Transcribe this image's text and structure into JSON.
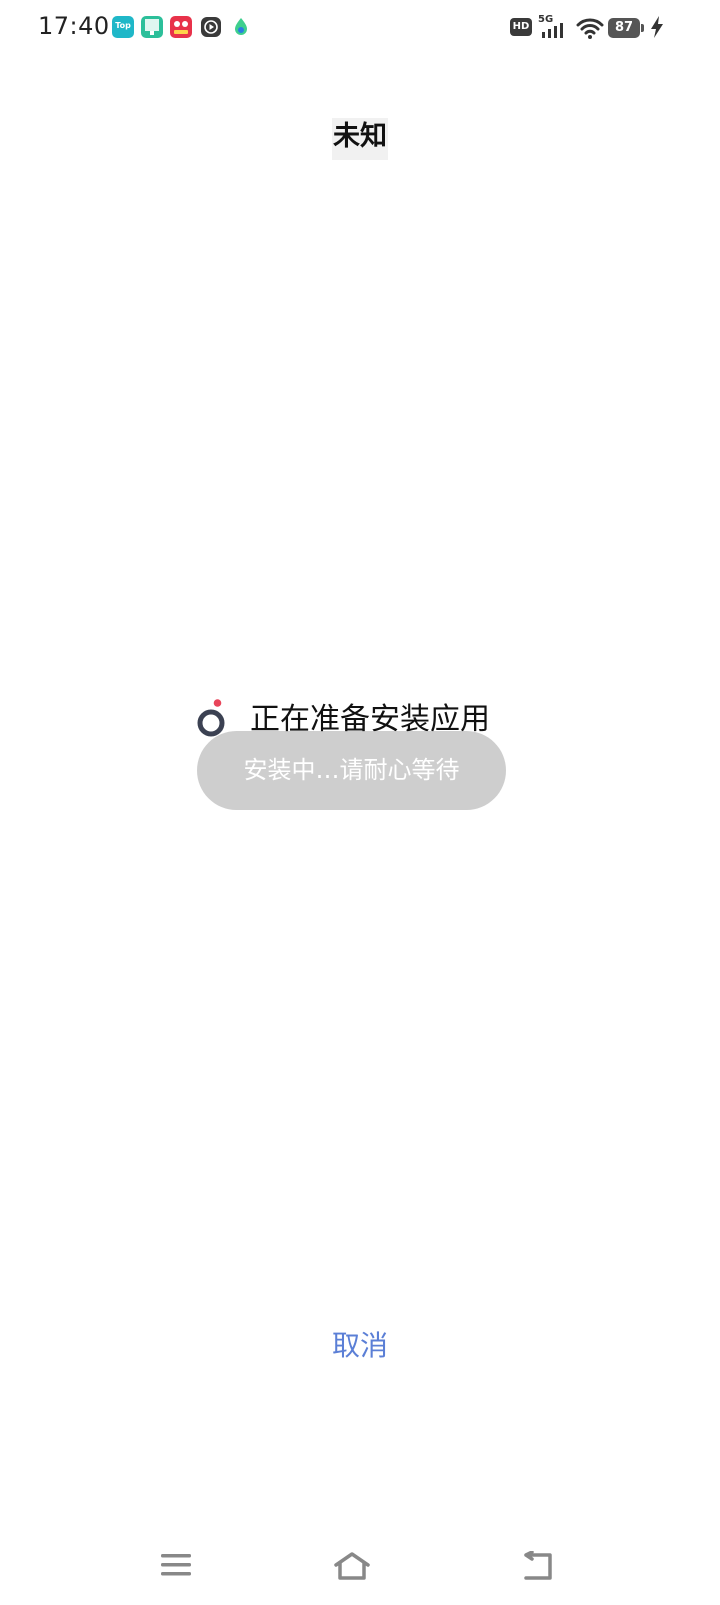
{
  "status_bar": {
    "time": "17:40",
    "notification_icons": [
      "app-top-icon",
      "app-green-icon",
      "app-red-icon",
      "media-play-icon",
      "app-green-drop-icon"
    ],
    "notification_icon_labels": {
      "app_top": "Top"
    },
    "hd_label": "HD",
    "network_label": "5G",
    "battery_level": "87"
  },
  "title": "未知",
  "progress": {
    "message": "正在准备安装应用"
  },
  "toast": {
    "message": "安装中…请耐心等待"
  },
  "actions": {
    "cancel_label": "取消"
  },
  "colors": {
    "accent": "#5b7fd6",
    "spinner_ring": "#3b4152",
    "spinner_dot": "#e8455a",
    "toast_background": "#bebebe"
  },
  "nav_bar": {
    "icons": [
      "menu-icon",
      "home-icon",
      "back-icon"
    ]
  }
}
